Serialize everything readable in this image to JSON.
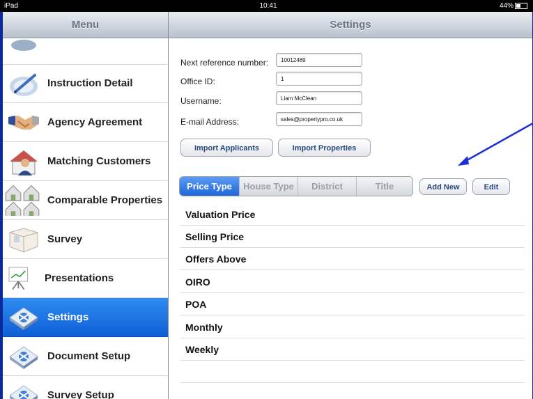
{
  "status": {
    "carrier": "iPad",
    "time": "10:41",
    "battery": "44%"
  },
  "left_nav": {
    "title": "Menu"
  },
  "right_nav": {
    "title": "Settings"
  },
  "sidebar": {
    "items": [
      {
        "label": "Instruction Detail",
        "icon": "pen-document-icon"
      },
      {
        "label": "Agency Agreement",
        "icon": "handshake-icon"
      },
      {
        "label": "Matching Customers",
        "icon": "house-person-icon"
      },
      {
        "label": "Comparable Properties",
        "icon": "houses-icon"
      },
      {
        "label": "Survey",
        "icon": "room-icon"
      },
      {
        "label": "Presentations",
        "icon": "easel-icon"
      },
      {
        "label": "Settings",
        "icon": "settings-icon",
        "active": true
      },
      {
        "label": "Document Setup",
        "icon": "document-setup-icon"
      },
      {
        "label": "Survey Setup",
        "icon": "survey-setup-icon"
      }
    ]
  },
  "form": {
    "next_ref_label": "Next reference number:",
    "next_ref_value": "10012489",
    "office_label": "Office ID:",
    "office_value": "1",
    "username_label": "Username:",
    "username_value": "Liam McClean",
    "email_label": "E-mail Address:",
    "email_value": "sales@propertypro.co.uk"
  },
  "buttons": {
    "import_applicants": "Import Applicants",
    "import_properties": "Import Properties",
    "add_new": "Add New",
    "edit": "Edit"
  },
  "segments": [
    "Price Type",
    "House Type",
    "District",
    "Title"
  ],
  "list": [
    "Valuation Price",
    "Selling Price",
    "Offers Above",
    "OIRO",
    "POA",
    "Monthly",
    "Weekly"
  ],
  "colors": {
    "accent": "#1f66d9",
    "annotation_arrow": "#1c2fd6",
    "background": "#0a2a9c"
  }
}
